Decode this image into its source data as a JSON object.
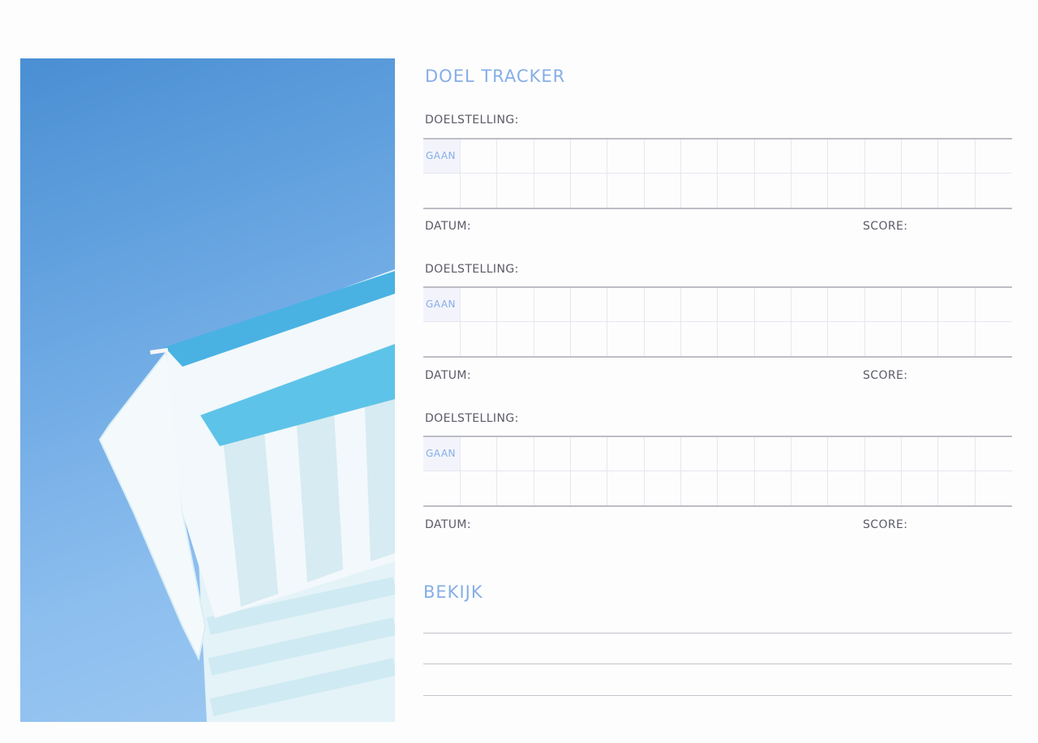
{
  "tracker": {
    "title": "DOEL TRACKER",
    "goal_label": "DOELSTELLING:",
    "gaan_label": "GAAN",
    "date_label": "DATUM:",
    "score_label": "SCORE:"
  },
  "review": {
    "title": "BEKIJK"
  },
  "colors": {
    "accent": "#86aee6",
    "text": "#5b5b66",
    "rule": "#bdbdc6",
    "sky": "#69a6e2",
    "umbrella_stripe": "#49b2e3"
  },
  "image": {
    "subject": "striped-beach-umbrella-photo"
  }
}
